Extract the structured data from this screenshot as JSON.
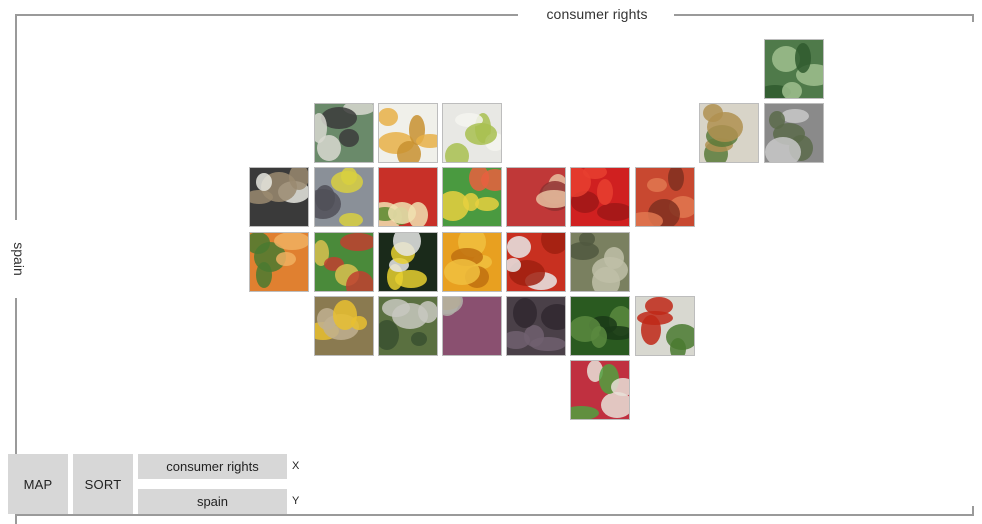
{
  "axes": {
    "x_title": "consumer rights",
    "y_title": "spain"
  },
  "controls": {
    "map_label": "MAP",
    "sort_label": "SORT",
    "x_value": "consumer rights",
    "y_value": "spain",
    "x_letter": "X",
    "y_letter": "Y"
  },
  "tiles": [
    {
      "id": "cucumbers-wrapped",
      "icon": "cucumber-photo",
      "colors": [
        "#4f7a4a",
        "#9fbf8e",
        "#2f5a2e"
      ]
    },
    {
      "id": "woman-poster",
      "icon": "poster-photo",
      "colors": [
        "#6a8a6a",
        "#d8d8d0",
        "#3b3b3b"
      ]
    },
    {
      "id": "chips-plate",
      "icon": "food-plate-photo",
      "colors": [
        "#f0f0ea",
        "#e8b048",
        "#c89030"
      ]
    },
    {
      "id": "lime-cup",
      "icon": "lime-photo",
      "colors": [
        "#e8e8e4",
        "#a8c050",
        "#f4f4f0"
      ]
    },
    {
      "id": "pineapple",
      "icon": "pineapple-photo",
      "colors": [
        "#d8d4c8",
        "#b09050",
        "#5a7a3a"
      ]
    },
    {
      "id": "greenhouse",
      "icon": "greenhouse-photo",
      "colors": [
        "#8a8a8a",
        "#5a6a4a",
        "#c8c8c8"
      ]
    },
    {
      "id": "rooftop-sign",
      "icon": "chalkboard-photo",
      "colors": [
        "#3a3a3a",
        "#9a8a70",
        "#e8e8e0"
      ]
    },
    {
      "id": "kitchen-fruit",
      "icon": "kitchen-photo",
      "colors": [
        "#8a9098",
        "#d8d040",
        "#505058"
      ]
    },
    {
      "id": "apples-cut",
      "icon": "apple-photo",
      "colors": [
        "#c83028",
        "#f0e0b0",
        "#5a8a30"
      ]
    },
    {
      "id": "painted-fruit",
      "icon": "painting-photo",
      "colors": [
        "#4a9a40",
        "#e8d040",
        "#e86040"
      ]
    },
    {
      "id": "apples-red",
      "icon": "apples-photo",
      "colors": [
        "#c03838",
        "#e8c0a0",
        "#903030"
      ]
    },
    {
      "id": "tomatoes-red",
      "icon": "tomatoes-photo",
      "colors": [
        "#d02020",
        "#e84030",
        "#a01818"
      ]
    },
    {
      "id": "tomatoes-vine",
      "icon": "vine-tomatoes-photo",
      "colors": [
        "#c84830",
        "#e07850",
        "#803020"
      ]
    },
    {
      "id": "papaya",
      "icon": "papaya-photo",
      "colors": [
        "#e08030",
        "#4a7a30",
        "#f0b060"
      ]
    },
    {
      "id": "veg-market",
      "icon": "market-photo",
      "colors": [
        "#4a8a3a",
        "#c04030",
        "#d8c050"
      ]
    },
    {
      "id": "lemons-bottle",
      "icon": "lemon-photo",
      "colors": [
        "#1a2a1a",
        "#e8d030",
        "#e8e8e8"
      ]
    },
    {
      "id": "oranges",
      "icon": "orange-photo",
      "colors": [
        "#e8a020",
        "#f0c040",
        "#c07010"
      ]
    },
    {
      "id": "tomato-crates",
      "icon": "crate-photo",
      "colors": [
        "#c83020",
        "#e8e8e8",
        "#a02010"
      ]
    },
    {
      "id": "artichokes",
      "icon": "artichoke-photo",
      "colors": [
        "#7a8060",
        "#c0c0a8",
        "#505840"
      ]
    },
    {
      "id": "sunflower",
      "icon": "flower-photo",
      "colors": [
        "#8a7a50",
        "#e8c030",
        "#c0b090"
      ]
    },
    {
      "id": "green-beans",
      "icon": "beans-photo",
      "colors": [
        "#5a7040",
        "#c8c8c0",
        "#3a5030"
      ]
    },
    {
      "id": "onion-crate",
      "icon": "onions-photo",
      "colors": [
        "#8a5070",
        "#b0b0a8",
        "#c89040"
      ]
    },
    {
      "id": "dark-fruit",
      "icon": "figs-photo",
      "colors": [
        "#4a4048",
        "#706070",
        "#302830"
      ]
    },
    {
      "id": "cucumbers",
      "icon": "cucumbers-photo",
      "colors": [
        "#2a5a20",
        "#5a8a40",
        "#1a3a18"
      ]
    },
    {
      "id": "tomato-branch",
      "icon": "tomato-branch-photo",
      "colors": [
        "#d8d8d0",
        "#c02818",
        "#4a7a30"
      ]
    },
    {
      "id": "colorful-stall",
      "icon": "stall-photo",
      "colors": [
        "#c03040",
        "#e8e0d8",
        "#50a040"
      ]
    }
  ]
}
